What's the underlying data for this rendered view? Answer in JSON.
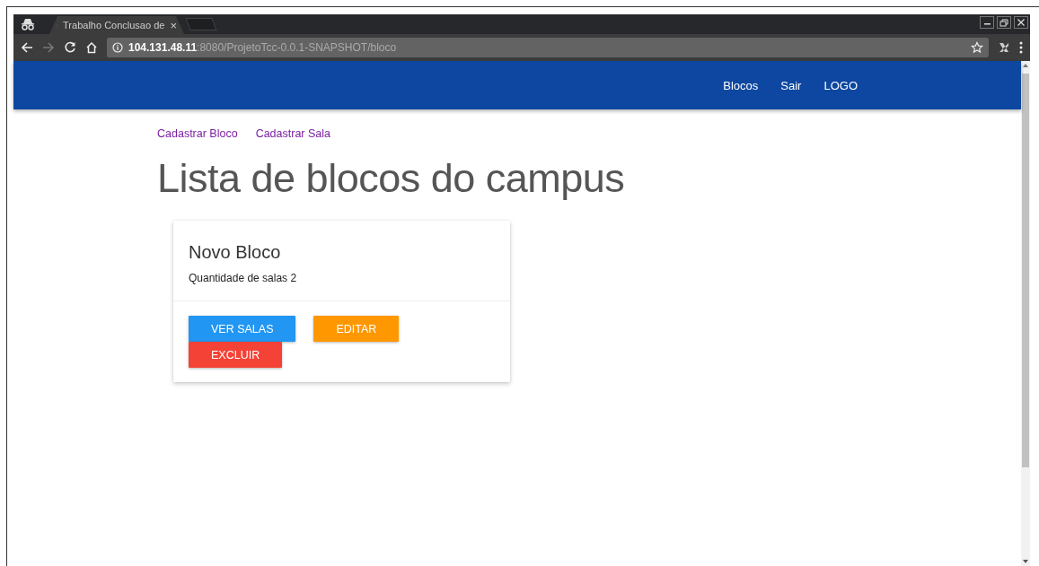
{
  "browser": {
    "tab_title": "Trabalho Conclusao de",
    "tab_close": "×",
    "address": "**104.131.48.11**:8080/ProjetoTcc-0.0.1-SNAPSHOT/bloco"
  },
  "navbar": {
    "links": [
      "Blocos",
      "Sair",
      "LOGO"
    ]
  },
  "actions": [
    "Cadastrar Bloco",
    "Cadastrar Sala"
  ],
  "heading": "Lista de blocos do campus",
  "cards": [
    {
      "title": "Novo Bloco",
      "text": "Quantidade de salas 2",
      "buttons": [
        {
          "label": "VER SALAS",
          "color": "#2196f3"
        },
        {
          "label": "EDITAR",
          "color": "#ff9800"
        },
        {
          "label": "EXCLUIR",
          "color": "#f44336"
        }
      ]
    }
  ]
}
